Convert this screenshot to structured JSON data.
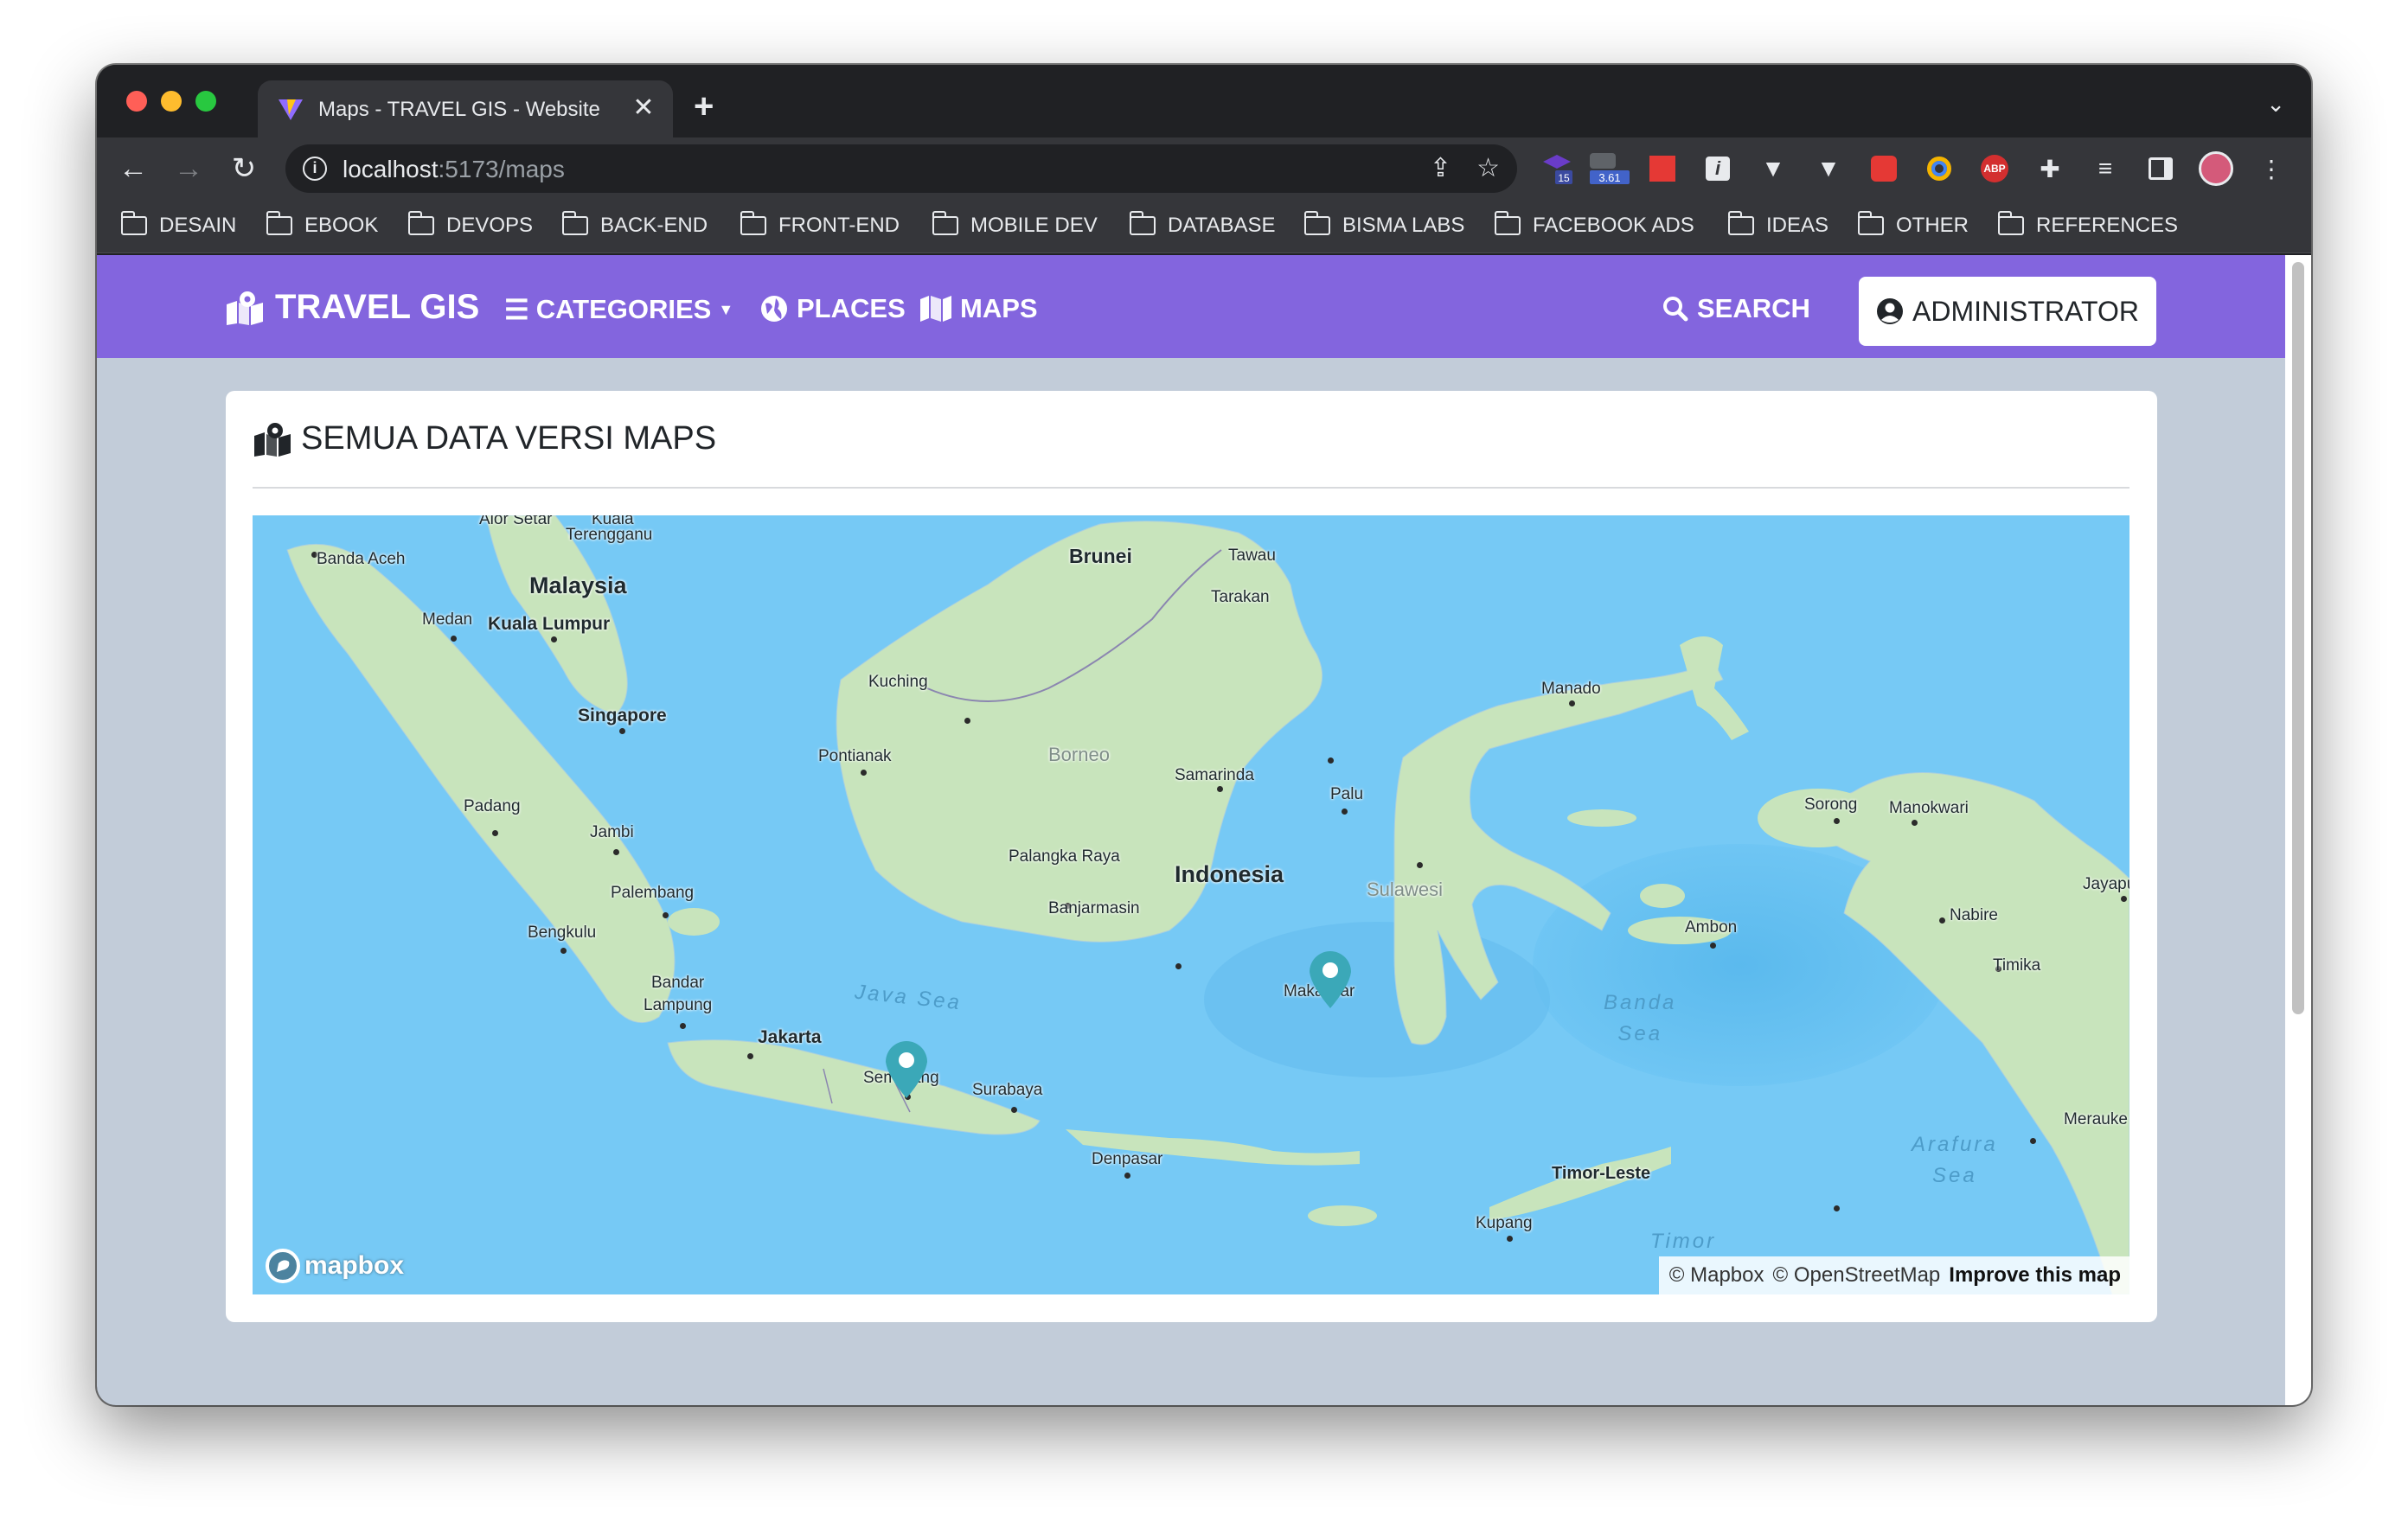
{
  "browser": {
    "tab_title": "Maps - TRAVEL GIS - Website",
    "tab_close": "✕",
    "new_tab": "+",
    "url_host": "localhost",
    "url_path": ":5173/maps",
    "extensions": {
      "badge_1": "15",
      "badge_2": "3.61",
      "abp": "ABP"
    },
    "bookmarks": [
      "DESAIN",
      "EBOOK",
      "DEVOPS",
      "BACK-END",
      "FRONT-END",
      "MOBILE DEV",
      "DATABASE",
      "BISMA LABS",
      "FACEBOOK ADS",
      "IDEAS",
      "OTHER",
      "REFERENCES"
    ]
  },
  "navbar": {
    "brand": "TRAVEL GIS",
    "categories": "CATEGORIES",
    "places": "PLACES",
    "maps": "MAPS",
    "search": "SEARCH",
    "administrator": "ADMINISTRATOR"
  },
  "card": {
    "title": "SEMUA DATA VERSI MAPS"
  },
  "map": {
    "labels": {
      "brunei": "Brunei",
      "tawau": "Tawau",
      "tarakan": "Tarakan",
      "banda_aceh": "Banda Aceh",
      "malaysia": "Malaysia",
      "terengganu": "Terengganu",
      "kuala": "Kuala",
      "alor_setar": "Alor Setar",
      "medan": "Medan",
      "kuala_lumpur": "Kuala Lumpur",
      "kuching": "Kuching",
      "manado": "Manado",
      "singapore": "Singapore",
      "pontianak": "Pontianak",
      "borneo": "Borneo",
      "samarinda": "Samarinda",
      "palu": "Palu",
      "sorong": "Sorong",
      "manokwari": "Manokwari",
      "padang": "Padang",
      "jambi": "Jambi",
      "palangka_raya": "Palangka Raya",
      "indonesia": "Indonesia",
      "sulawesi": "Sulawesi",
      "jayapura": "Jayapu",
      "palembang": "Palembang",
      "banjarmasin": "Banjarmasin",
      "nabire": "Nabire",
      "ambon": "Ambon",
      "bengkulu": "Bengkulu",
      "timika": "Timika",
      "bandar_lampung": "Bandar\nLampung",
      "java_sea": "Java Sea",
      "makassar": "Makassar",
      "banda_sea": "Banda\nSea",
      "jakarta": "Jakarta",
      "semarang": "Semarang",
      "surabaya": "Surabaya",
      "merauke": "Merauke",
      "arafura_sea": "Arafura\nSea",
      "denpasar": "Denpasar",
      "timor_leste": "Timor-Leste",
      "kupang": "Kupang",
      "timor": "Timor"
    },
    "logo": "mapbox",
    "attribution_mapbox": "© Mapbox",
    "attribution_osm": "© OpenStreetMap",
    "attribution_improve": "Improve this map",
    "colors": {
      "sea": "#76c9f5",
      "land": "#c8e4bc",
      "marker": "#3ba8b8"
    }
  },
  "colors": {
    "navbar": "#8365de",
    "page_background": "#c2ccd9"
  }
}
